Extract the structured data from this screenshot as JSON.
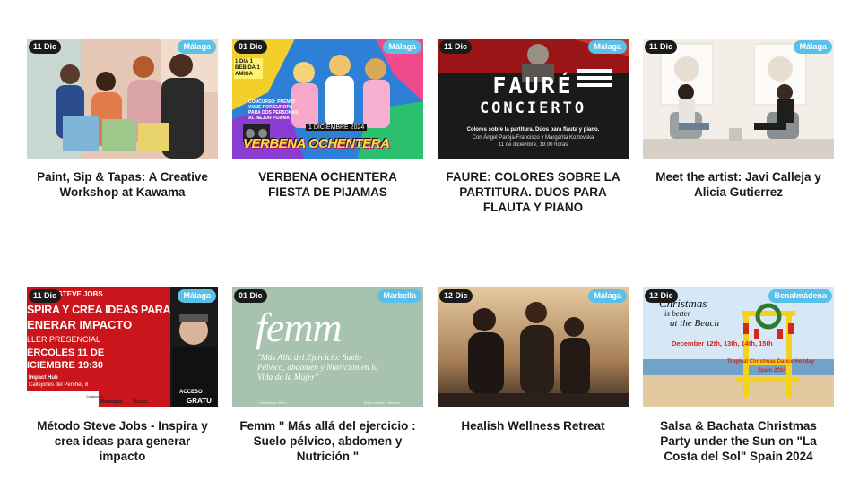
{
  "events": [
    {
      "date": "11 Dic",
      "city": "Málaga",
      "title": "Paint, Sip & Tapas: A Creative Workshop at Kawama"
    },
    {
      "date": "01 Dic",
      "city": "Málaga",
      "title": "VERBENA OCHENTERA FIESTA DE PIJAMAS",
      "poster": {
        "date_line": "1 DICIEMBRE 2024",
        "headline": "VERBENA OCHENTERA",
        "corner": "1 DIA 1 BEBIDA 1 AMIGA",
        "contest": "CONCURSO: PREMIO VIAJE POR EUROPA PARA DOS PERSONAS AL MEJOR PIJAMA"
      }
    },
    {
      "date": "11 Dic",
      "city": "Málaga",
      "title": "FAURE: COLORES SOBRE LA PARTITURA. DUOS PARA FLAUTA Y PIANO",
      "poster": {
        "line1": "FAURÉ",
        "line2": "CONCIERTO",
        "sub1": "Colores sobre la partitura. Dúos para flauta y piano.",
        "sub2": "Con Ángel Pareja-Francisco y Margarita Kozlovska",
        "sub3": "11 de diciembre, 19.00 horas"
      }
    },
    {
      "date": "11 Dic",
      "city": "Málaga",
      "title": "Meet the artist: Javi Calleja y Alicia Gutierrez"
    },
    {
      "date": "11 Dic",
      "city": "Málaga",
      "title": "Método Steve Jobs - Inspira y crea ideas para generar impacto",
      "poster": {
        "l1": "ÉTODO STEVE JOBS",
        "l2": "SPIRA Y CREA IDEAS PARA",
        "l3": "ENERAR IMPACTO",
        "l4": "LLER PRESENCIAL",
        "l5": "ÉRCOLES 11 DE",
        "l6": "ICIEMBRE 19:30",
        "l7": "Impact Hub",
        "l8": "Callejones del Perchel, 8",
        "l9": "ACCESO",
        "l10": "GRATU",
        "l11": "Colaboran:",
        "l12": "Metacards",
        "l13": "Málaga"
      }
    },
    {
      "date": "01 Dic",
      "city": "Marbella",
      "title": "Femm \" Más allá del ejercicio : Suelo pélvico, abdomen y Nutrición \"",
      "poster": {
        "big": "femm",
        "sub": "\"Más Allá del Ejercicio: Suelo Pélvico, abdomen y Nutrición en la Vida de la Mujer\"",
        "foot_left": "1 Diciembre 2024 / ...",
        "foot_right": "Ticket events + Brunch"
      }
    },
    {
      "date": "12 Dic",
      "city": "Málaga",
      "title": "Healish Wellness Retreat"
    },
    {
      "date": "12 Dic",
      "city": "Benalmádena",
      "title": "Salsa & Bachata Christmas Party under the Sun on \"La Costa del Sol\" Spain 2024",
      "poster": {
        "t1": "Christmas",
        "t2": "is better",
        "t3": "at the Beach",
        "dates": "December 12th, 13th, 14th, 15th",
        "t4": "Tropical Christmas Dance Holiday",
        "t5": "Spain 2024"
      }
    }
  ],
  "colors": {
    "date_badge": "#1b1b1b",
    "city_badge": "#5bc0e8",
    "title_text": "#1a1a1a"
  }
}
